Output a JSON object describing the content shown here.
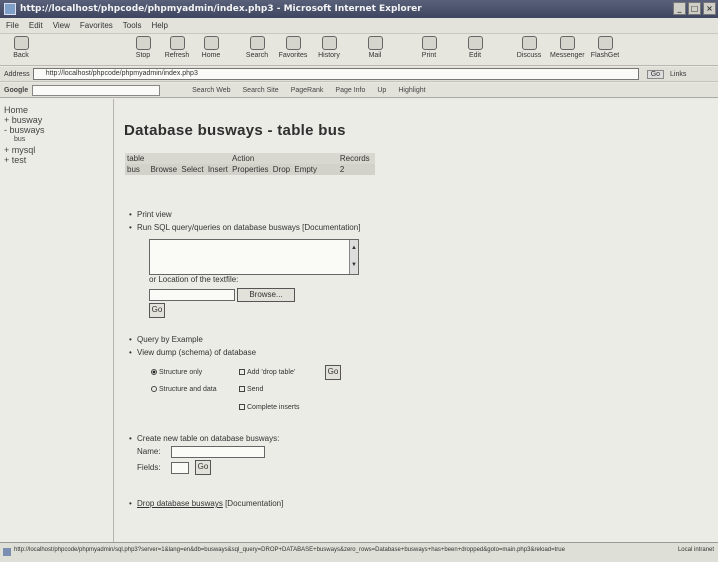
{
  "window": {
    "title": "http://localhost/phpcode/phpmyadmin/index.php3 - Microsoft Internet Explorer"
  },
  "menu": [
    "File",
    "Edit",
    "View",
    "Favorites",
    "Tools",
    "Help"
  ],
  "toolbar": {
    "buttons": [
      {
        "label": "Back"
      },
      {
        "label": "Stop"
      },
      {
        "label": "Refresh"
      },
      {
        "label": "Home"
      },
      {
        "label": "Search"
      },
      {
        "label": "Favorites"
      },
      {
        "label": "History"
      },
      {
        "label": "Mail"
      },
      {
        "label": "Print"
      },
      {
        "label": "Edit"
      },
      {
        "label": "Discuss"
      },
      {
        "label": "Messenger"
      },
      {
        "label": "FlashGet"
      }
    ]
  },
  "addressbar": {
    "label": "Address",
    "url": "http://localhost/phpcode/phpmyadmin/index.php3",
    "go": "Go",
    "links": "Links"
  },
  "googlebar": {
    "label": "Google",
    "items": [
      "Search Web",
      "Search Site",
      "PageRank",
      "Page Info",
      "Up",
      "Highlight"
    ]
  },
  "sidebar": {
    "items": [
      {
        "label": "Home",
        "sub": false
      },
      {
        "label": "+ busway",
        "sub": false
      },
      {
        "label": "- busways",
        "sub": false
      },
      {
        "label": "bus",
        "sub": true
      },
      {
        "label": "+ mysql",
        "sub": false
      },
      {
        "label": "+ test",
        "sub": false
      }
    ]
  },
  "main": {
    "title": "Database busways - table bus",
    "table": {
      "headers": {
        "table": "table",
        "action": "Action",
        "records": "Records"
      },
      "row": {
        "name": "bus",
        "actions": [
          "Browse",
          "Select",
          "Insert",
          "Properties",
          "Drop",
          "Empty"
        ],
        "records": "2"
      }
    },
    "print_view": "Print view",
    "run_sql": "Run SQL query/queries on database busways",
    "documentation": "[Documentation]",
    "location_label": "or Location of the textfile:",
    "browse": "Browse...",
    "go": "Go",
    "query_by_example": "Query by Example",
    "view_dump": "View dump (schema) of database",
    "structure_only": "Structure only",
    "structure_and_data": "Structure and data",
    "add_drop_table": "Add 'drop table'",
    "send": "Send",
    "complete_inserts": "Complete inserts",
    "create_table": "Create new table on database busways:",
    "name_label": "Name:",
    "fields_label": "Fields:",
    "drop_database": "Drop database busways"
  },
  "status": {
    "url": "http://localhost/phpcode/phpmyadmin/sql.php3?server=1&lang=en&db=busways&sql_query=DROP+DATABASE+busways&zero_rows=Database+busways+has+been+dropped&goto=main.php3&reload=true",
    "zone": "Local intranet"
  }
}
